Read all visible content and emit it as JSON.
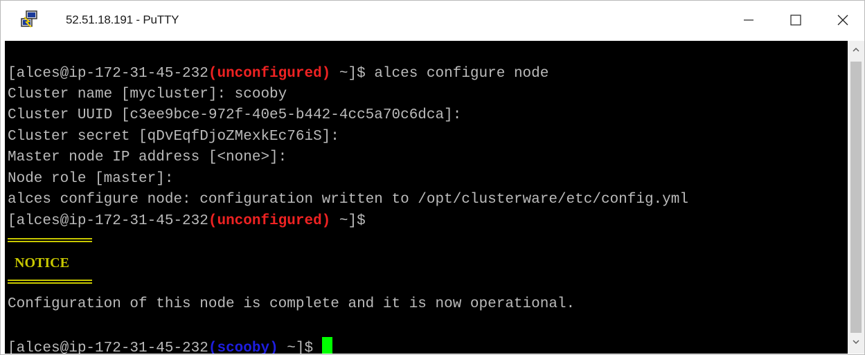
{
  "window": {
    "title": "52.51.18.191 - PuTTY",
    "icon": "putty-icon",
    "controls": {
      "minimize": "minimize-icon",
      "maximize": "maximize-icon",
      "close": "close-icon"
    }
  },
  "terminal": {
    "lines": [
      {
        "prompt_user": "[alces@ip-172-31-45-232",
        "prompt_state": "(unconfigured)",
        "prompt_tail": " ~]$ ",
        "command": "alces configure node"
      },
      {
        "text": "Cluster name [mycluster]: scooby"
      },
      {
        "text": "Cluster UUID [c3ee9bce-972f-40e5-b442-4cc5a70c6dca]:"
      },
      {
        "text": "Cluster secret [qDvEqfDjoZMexkEc76iS]:"
      },
      {
        "text": "Master node IP address [<none>]:"
      },
      {
        "text": "Node role [master]:"
      },
      {
        "text": "alces configure node: configuration written to /opt/clusterware/etc/config.yml"
      },
      {
        "prompt_user": "[alces@ip-172-31-45-232",
        "prompt_state": "(unconfigured)",
        "prompt_tail": " ~]$"
      },
      {
        "text": "NOTICE"
      },
      {
        "text": "Configuration of this node is complete and it is now operational."
      },
      {
        "prompt_user": "[alces@ip-172-31-45-232",
        "prompt_state": "(scooby)",
        "prompt_tail": " ~]$ "
      }
    ],
    "colors": {
      "background": "#000000",
      "foreground": "#bbbbbb",
      "unconfigured": "#ee2222",
      "configured": "#1e1ee0",
      "notice": "#c8c800",
      "cursor": "#00ff00"
    }
  },
  "scrollbar": {
    "up": "chevron-up-icon",
    "down": "chevron-down-icon"
  }
}
